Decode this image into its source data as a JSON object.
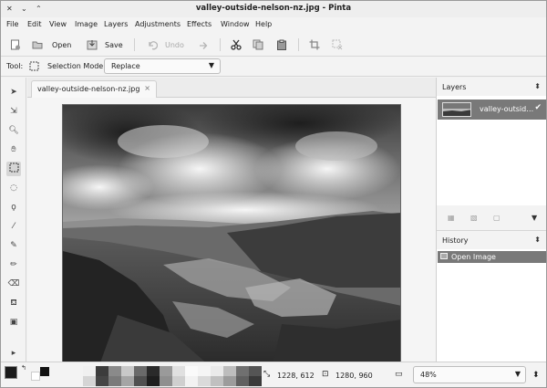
{
  "window": {
    "title": "valley-outside-nelson-nz.jpg - Pinta"
  },
  "menu": [
    "File",
    "Edit",
    "View",
    "Image",
    "Layers",
    "Adjustments",
    "Effects",
    "Window",
    "Help"
  ],
  "toolbar": {
    "open_label": "Open",
    "save_label": "Save",
    "undo_label": "Undo"
  },
  "options": {
    "tool_label": "Tool:",
    "selection_mode_label": "Selection Mode:",
    "selection_mode_value": "Replace"
  },
  "document": {
    "tab_label": "valley-outside-nelson-nz.jpg",
    "tab_close": "×"
  },
  "layers_panel": {
    "title": "Layers",
    "layer_name": "valley-outsid…",
    "visible_check": "✔"
  },
  "history_panel": {
    "title": "History",
    "items": [
      "Open Image"
    ]
  },
  "status": {
    "cursor_position": "1228, 612",
    "image_size": "1280, 960",
    "zoom": "48%"
  },
  "colors": {
    "primary": "#1a1a1a",
    "secondary": "#ffffff",
    "selection": "#797979"
  },
  "tools": [
    "pointer-icon",
    "move-selection-icon",
    "zoom-icon",
    "pan-icon",
    "rectangle-select-icon",
    "ellipse-select-icon",
    "lasso-icon",
    "magic-wand-icon",
    "paintbrush-icon",
    "pencil-icon",
    "eraser-icon",
    "paint-bucket-icon",
    "clone-stamp-icon",
    "more-tools-icon"
  ]
}
